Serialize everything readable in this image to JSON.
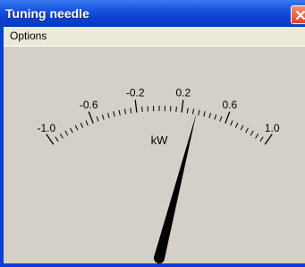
{
  "window": {
    "title": "Tuning needle"
  },
  "menu": {
    "items": [
      {
        "label": "Options"
      }
    ]
  },
  "meter": {
    "unit": "kW",
    "scale_min": -1.0,
    "scale_max": 1.0,
    "tick_labels": [
      "-1.0",
      "-0.6",
      "-0.2",
      "0.2",
      "0.6",
      "1.0"
    ],
    "needle_value": 0.33,
    "colors": {
      "face": "#d4d0c8",
      "scale": "#000000",
      "title_bar": "#0a3ac4",
      "close_button": "#d9432a"
    }
  }
}
